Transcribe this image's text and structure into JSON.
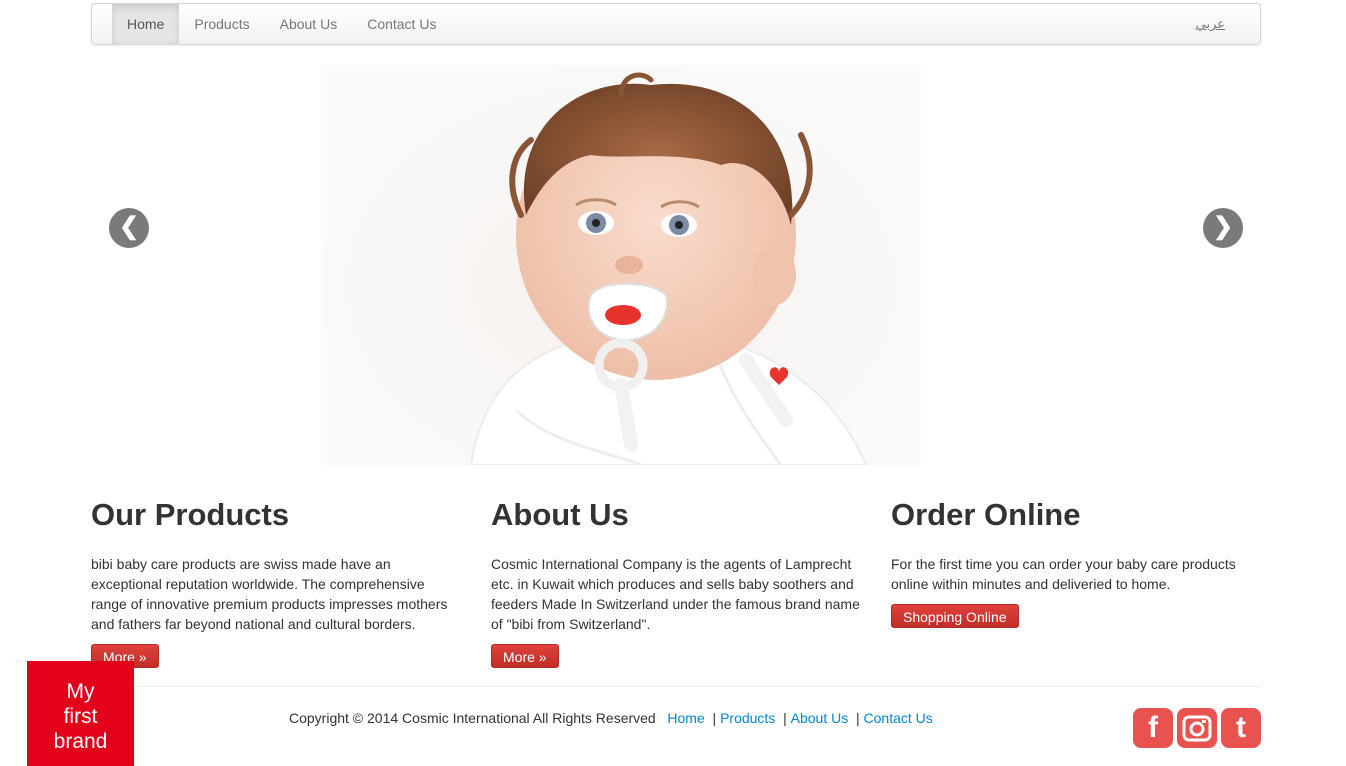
{
  "nav": {
    "items": [
      "Home",
      "Products",
      "About Us",
      "Contact Us"
    ],
    "lang": "عربي"
  },
  "carousel": {
    "prev": "❮",
    "next": "❯"
  },
  "sections": [
    {
      "title": "Our Products",
      "body": "bibi baby care products are swiss made have an exceptional reputation worldwide. The comprehensive range of innovative premium products impresses mothers and fathers far beyond national and cultural borders.",
      "button": "More »"
    },
    {
      "title": "About Us",
      "body": "Cosmic International Company is the agents of Lamprecht etc. in Kuwait which produces and sells baby soothers and feeders Made In Switzerland under the famous brand name of \"bibi from Switzerland\".",
      "button": "More »"
    },
    {
      "title": "Order Online",
      "body": "For the first time you can order your baby care products online within minutes and deliveried to home.",
      "button": "Shopping Online"
    }
  ],
  "footer": {
    "copyright": "Copyright © 2014 Cosmic International All Rights Reserved",
    "links": [
      "Home",
      "Products",
      "About Us",
      "Contact Us"
    ]
  },
  "brand": {
    "line1": "My",
    "line2": "first",
    "line3": "brand"
  },
  "social": {
    "facebook": "f",
    "twitter": "t"
  }
}
